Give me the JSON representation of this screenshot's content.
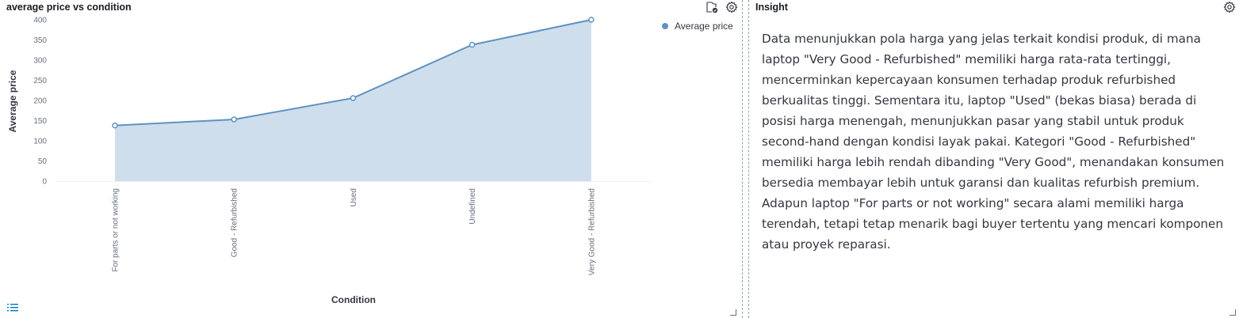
{
  "chart_panel": {
    "title": "average price vs condition"
  },
  "insight_panel": {
    "title": "Insight",
    "text": "Data menunjukkan pola harga yang jelas terkait kondisi produk, di mana laptop \"Very Good - Refurbished\" memiliki harga rata-rata tertinggi, mencerminkan kepercayaan konsumen terhadap produk refurbished berkualitas tinggi. Sementara itu, laptop \"Used\" (bekas biasa) berada di posisi harga menengah, menunjukkan pasar yang stabil untuk produk second-hand dengan kondisi layak pakai. Kategori \"Good - Refurbished\" memiliki harga lebih rendah dibanding \"Very Good\", menandakan konsumen bersedia membayar lebih untuk garansi dan kualitas refurbish premium. Adapun laptop \"For parts or not working\" secara alami memiliki harga terendah, tetapi tetap menarik bagi buyer tertentu yang mencari komponen atau proyek reparasi."
  },
  "icons": {
    "chart_inspect": "inspect-icon",
    "chart_settings": "gear-icon",
    "insight_settings": "gear-icon",
    "list_toggle": "list-icon"
  },
  "colors": {
    "series_line": "#6092c0",
    "series_fill": "#cfdeed",
    "grid": "#eef0f3"
  },
  "chart_data": {
    "type": "area",
    "title": "average price vs condition",
    "xlabel": "Condition",
    "ylabel": "Average price",
    "categories": [
      "For parts or not working",
      "Good - Refurbished",
      "Used",
      "Undefined",
      "Very Good - Refurbished"
    ],
    "series": [
      {
        "name": "Average price",
        "values": [
          138,
          153,
          206,
          338,
          400
        ]
      }
    ],
    "ylim": [
      0,
      400
    ],
    "yticks": [
      0,
      50,
      100,
      150,
      200,
      250,
      300,
      350,
      400
    ],
    "legend": "top-right",
    "grid": false
  }
}
